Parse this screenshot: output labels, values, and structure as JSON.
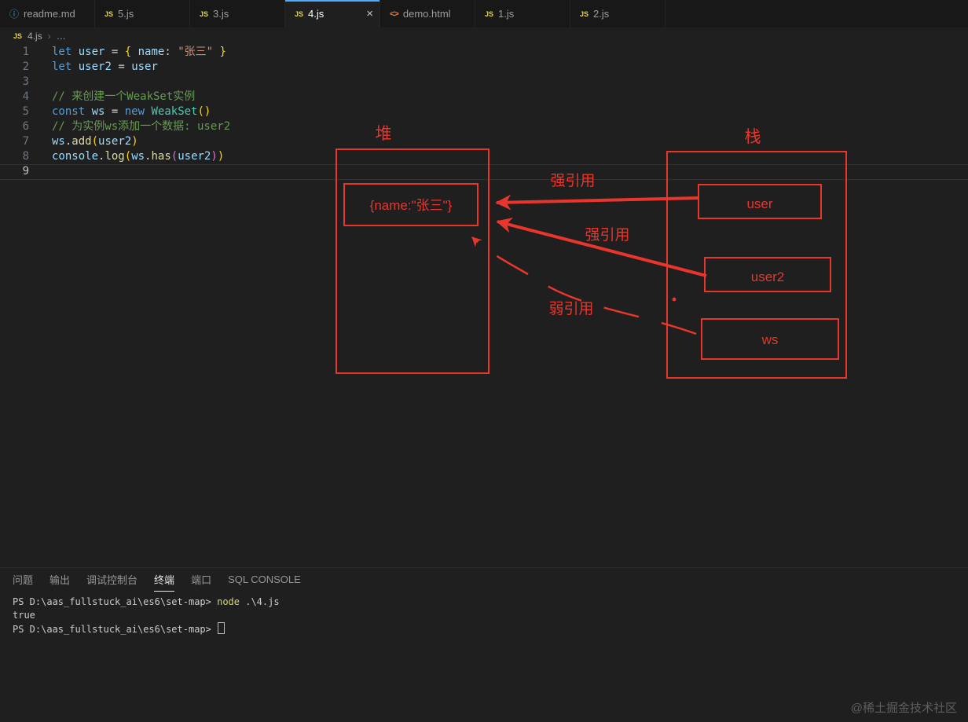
{
  "colors": {
    "accent": "#4daafc",
    "annotation": "#e8362d"
  },
  "icon_glyphs": {
    "js": "JS",
    "md": "ⓘ",
    "html": "<>"
  },
  "tabs": [
    {
      "label": "readme.md",
      "icon": "md",
      "active": false
    },
    {
      "label": "5.js",
      "icon": "js",
      "active": false
    },
    {
      "label": "3.js",
      "icon": "js",
      "active": false
    },
    {
      "label": "4.js",
      "icon": "js",
      "active": true
    },
    {
      "label": "demo.html",
      "icon": "html",
      "active": false
    },
    {
      "label": "1.js",
      "icon": "js",
      "active": false
    },
    {
      "label": "2.js",
      "icon": "js",
      "active": false
    }
  ],
  "breadcrumb": {
    "icon": "JS",
    "file": "4.js",
    "sep": "›",
    "more": "…"
  },
  "editor": {
    "lines": [
      {
        "n": "1",
        "t": [
          [
            "k",
            "let"
          ],
          [
            "d",
            " "
          ],
          [
            "v",
            "user"
          ],
          [
            "d",
            " = "
          ],
          [
            "b1",
            "{"
          ],
          [
            "d",
            " "
          ],
          [
            "v",
            "name"
          ],
          [
            "d",
            ": "
          ],
          [
            "s",
            "\"张三\""
          ],
          [
            "d",
            " "
          ],
          [
            "b1",
            "}"
          ]
        ]
      },
      {
        "n": "2",
        "t": [
          [
            "k",
            "let"
          ],
          [
            "d",
            " "
          ],
          [
            "v",
            "user2"
          ],
          [
            "d",
            " = "
          ],
          [
            "v",
            "user"
          ]
        ]
      },
      {
        "n": "3",
        "t": []
      },
      {
        "n": "4",
        "t": [
          [
            "c",
            "// 来创建一个WeakSet实例"
          ]
        ]
      },
      {
        "n": "5",
        "t": [
          [
            "k",
            "const"
          ],
          [
            "d",
            " "
          ],
          [
            "v",
            "ws"
          ],
          [
            "d",
            " = "
          ],
          [
            "k",
            "new"
          ],
          [
            "d",
            " "
          ],
          [
            "t",
            "WeakSet"
          ],
          [
            "b1",
            "()"
          ]
        ]
      },
      {
        "n": "6",
        "t": [
          [
            "c",
            "// 为实例ws添加一个数据: user2"
          ]
        ]
      },
      {
        "n": "7",
        "t": [
          [
            "v",
            "ws"
          ],
          [
            "d",
            "."
          ],
          [
            "f",
            "add"
          ],
          [
            "b1",
            "("
          ],
          [
            "v",
            "user2"
          ],
          [
            "b1",
            ")"
          ]
        ]
      },
      {
        "n": "8",
        "t": [
          [
            "v",
            "console"
          ],
          [
            "d",
            "."
          ],
          [
            "f",
            "log"
          ],
          [
            "b1",
            "("
          ],
          [
            "v",
            "ws"
          ],
          [
            "d",
            "."
          ],
          [
            "f",
            "has"
          ],
          [
            "b2",
            "("
          ],
          [
            "v",
            "user2"
          ],
          [
            "b2",
            ")"
          ],
          [
            "b1",
            ")"
          ]
        ]
      },
      {
        "n": "9",
        "t": [],
        "current": true
      }
    ]
  },
  "diagram": {
    "heap_label": "堆",
    "stack_label": "栈",
    "object_label": "{name:\"张三\"}",
    "stack_items": {
      "user": "user",
      "user2": "user2",
      "ws": "ws"
    },
    "strong_ref_1": "强引用",
    "strong_ref_2": "强引用",
    "weak_ref": "弱引用"
  },
  "panel": {
    "tabs": [
      {
        "label": "问题",
        "active": false
      },
      {
        "label": "输出",
        "active": false
      },
      {
        "label": "调试控制台",
        "active": false
      },
      {
        "label": "终端",
        "active": true
      },
      {
        "label": "端口",
        "active": false
      },
      {
        "label": "SQL CONSOLE",
        "active": false
      }
    ]
  },
  "terminal": {
    "lines": [
      {
        "spans": [
          [
            "p",
            "PS D:\\aas_fullstuck_ai\\es6\\set-map> "
          ],
          [
            "y",
            "node"
          ],
          [
            "w",
            " .\\4.js"
          ]
        ],
        "cursor": false
      },
      {
        "spans": [
          [
            "w",
            "true"
          ]
        ],
        "cursor": false
      },
      {
        "spans": [
          [
            "p",
            "PS D:\\aas_fullstuck_ai\\es6\\set-map> "
          ]
        ],
        "cursor": true
      }
    ]
  },
  "watermark": "@稀土掘金技术社区"
}
